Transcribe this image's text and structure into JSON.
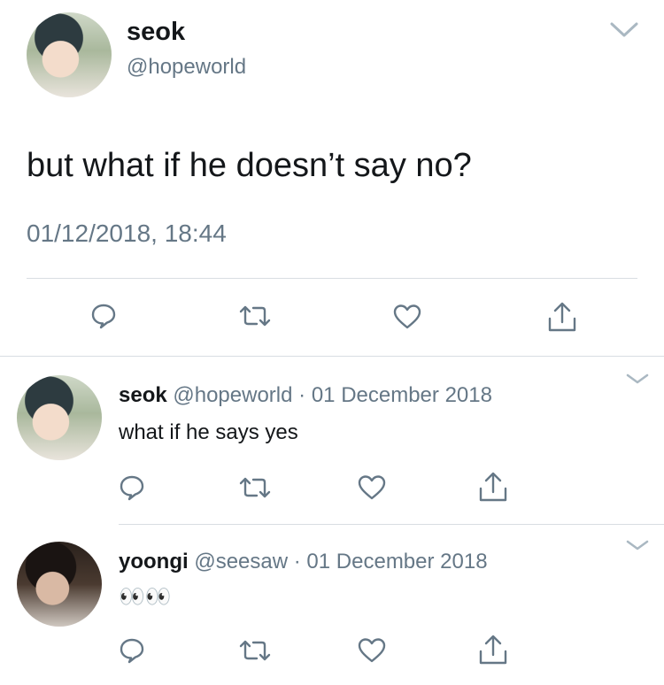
{
  "main_tweet": {
    "display_name": "seok",
    "handle": "@hopeworld",
    "text": "but what if he doesn’t say no?",
    "timestamp": "01/12/2018, 18:44"
  },
  "replies": [
    {
      "display_name": "seok",
      "handle": "@hopeworld",
      "separator": "·",
      "date": "01 December 2018",
      "text": "what if he says yes"
    },
    {
      "display_name": "yoongi",
      "handle": "@seesaw",
      "separator": "·",
      "date": "01 December 2018",
      "text": "👀👀"
    }
  ],
  "icons": {
    "reply": "speech-bubble-icon",
    "retweet": "retweet-icon",
    "like": "heart-icon",
    "share": "share-icon",
    "more": "chevron-down-icon"
  },
  "colors": {
    "text": "#14171a",
    "secondary": "#657786",
    "icon": "#657786",
    "divider": "#d8dde2"
  }
}
